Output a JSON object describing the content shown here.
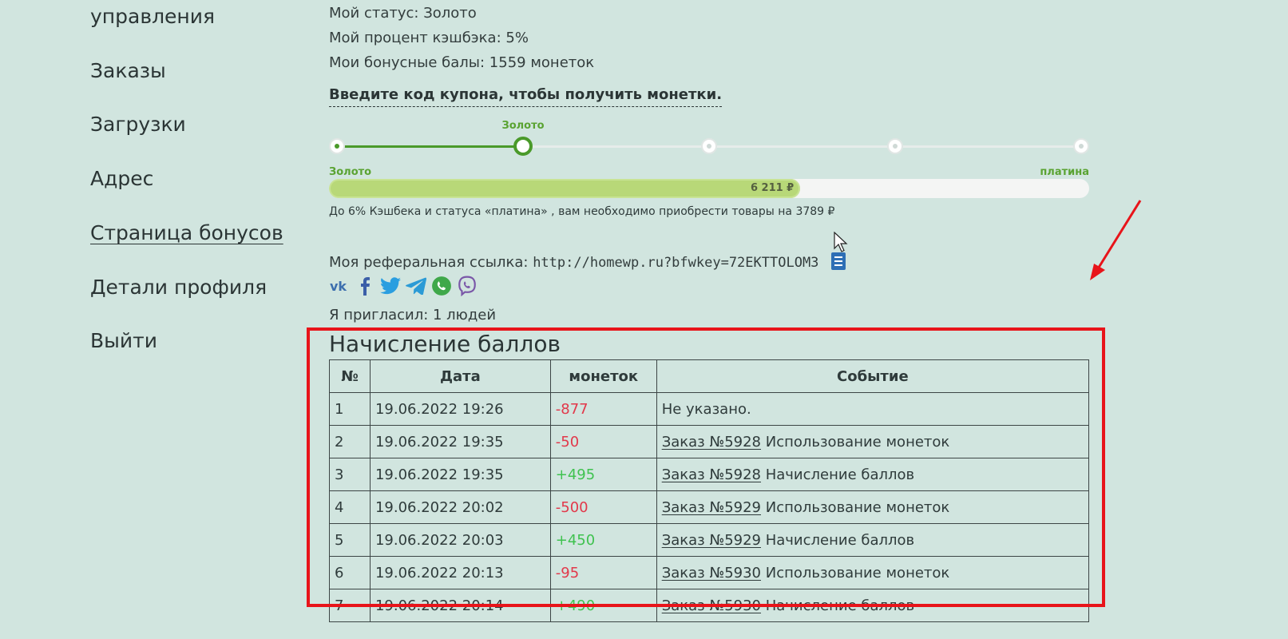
{
  "sidebar": {
    "items": [
      {
        "label": "управления"
      },
      {
        "label": "Заказы"
      },
      {
        "label": "Загрузки"
      },
      {
        "label": "Адрес"
      },
      {
        "label": "Страница бонусов"
      },
      {
        "label": "Детали профиля"
      },
      {
        "label": "Выйти"
      }
    ]
  },
  "status": {
    "status_line": "Мой статус: Золото",
    "cashback_line": "Мой процент кэшбэка: 5%",
    "bonus_line": "Мои бонусные балы: 1559 монеток"
  },
  "coupon": {
    "link_label": "Введите код купона, чтобы получить монетки."
  },
  "levels": {
    "current_label": "Золото",
    "current_step": 2,
    "total_steps": 5
  },
  "progress": {
    "left_label": "Золото",
    "right_label": "платина",
    "value_label": "6 211 ₽",
    "fraction": 0.62
  },
  "hint": "До 6% Кэшбека и статуса «платина» , вам необходимо приобрести товары на 3789 ₽",
  "referral": {
    "label": "Моя реферальная ссылка:",
    "url": "http://homewp.ru?bfwkey=72EKTTOLOM3"
  },
  "social_icons": [
    "vk-icon",
    "facebook-icon",
    "twitter-icon",
    "telegram-icon",
    "whatsapp-icon",
    "viber-icon"
  ],
  "invited": "Я пригласил: 1 людей",
  "history": {
    "title": "Начисление баллов",
    "columns": [
      "№",
      "Дата",
      "монеток",
      "Событие"
    ],
    "rows": [
      {
        "n": "1",
        "date": "19.06.2022 19:26",
        "amount": "-877",
        "order": "",
        "event": "Не указано."
      },
      {
        "n": "2",
        "date": "19.06.2022 19:35",
        "amount": "-50",
        "order": "Заказ №5928",
        "event": "Использование монеток"
      },
      {
        "n": "3",
        "date": "19.06.2022 19:35",
        "amount": "+495",
        "order": "Заказ №5928",
        "event": "Начисление баллов"
      },
      {
        "n": "4",
        "date": "19.06.2022 20:02",
        "amount": "-500",
        "order": "Заказ №5929",
        "event": "Использование монеток"
      },
      {
        "n": "5",
        "date": "19.06.2022 20:03",
        "amount": "+450",
        "order": "Заказ №5929",
        "event": "Начисление баллов"
      },
      {
        "n": "6",
        "date": "19.06.2022 20:13",
        "amount": "-95",
        "order": "Заказ №5930",
        "event": "Использование монеток"
      },
      {
        "n": "7",
        "date": "19.06.2022 20:14",
        "amount": "+490",
        "order": "Заказ №5930",
        "event": "Начисление баллов"
      }
    ]
  },
  "colors": {
    "background": "#d1e5df",
    "accent_green": "#4a9a2a",
    "negative": "#e2384a",
    "positive": "#3fc24f",
    "annotation_red": "#e8141a"
  }
}
